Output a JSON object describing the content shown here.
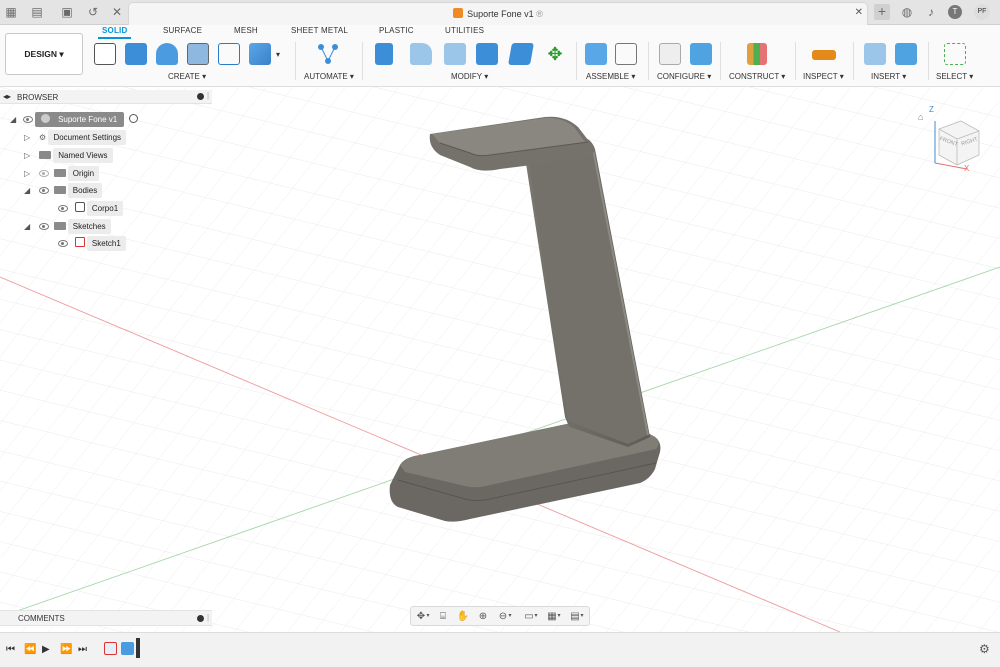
{
  "app": {
    "document_title": "Suporte Fone v1",
    "unsaved_marker": "®",
    "user_initials": "PF"
  },
  "workspace": {
    "design_label": "DESIGN ▾",
    "tabs": [
      "SOLID",
      "SURFACE",
      "MESH",
      "SHEET METAL",
      "PLASTIC",
      "UTILITIES"
    ],
    "active_tab": "SOLID"
  },
  "toolbar_groups": [
    {
      "label": "CREATE ▾"
    },
    {
      "label": "AUTOMATE ▾"
    },
    {
      "label": "MODIFY ▾"
    },
    {
      "label": "ASSEMBLE ▾"
    },
    {
      "label": "CONFIGURE ▾"
    },
    {
      "label": "CONSTRUCT ▾"
    },
    {
      "label": "INSPECT ▾"
    },
    {
      "label": "INSERT ▾"
    },
    {
      "label": "SELECT ▾"
    }
  ],
  "browser": {
    "title": "BROWSER",
    "items": [
      {
        "label": "Suporte Fone v1"
      },
      {
        "label": "Document Settings"
      },
      {
        "label": "Named Views"
      },
      {
        "label": "Origin"
      },
      {
        "label": "Bodies"
      },
      {
        "label": "Corpo1"
      },
      {
        "label": "Sketches"
      },
      {
        "label": "Sketch1"
      }
    ]
  },
  "comments": {
    "title": "COMMENTS"
  },
  "viewcube": {
    "front": "FRONT",
    "right": "RIGHT",
    "axis_z": "Z",
    "axis_x": "X"
  },
  "colors": {
    "accent": "#0696d7",
    "body": "#6e6b66",
    "x_axis": "#e57373",
    "y_axis": "#81c784"
  }
}
